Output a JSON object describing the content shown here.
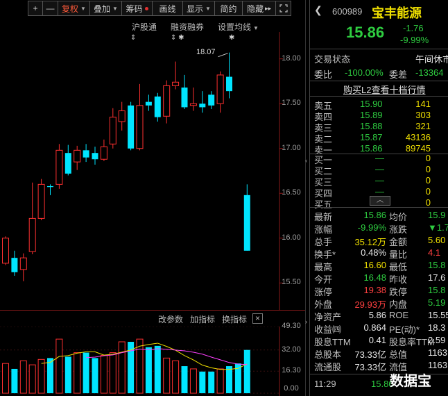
{
  "toolbar": {
    "plus": "+",
    "minus": "—",
    "fuquan": "复权",
    "diejia": "叠加",
    "chouma": "筹码",
    "huaxian": "画线",
    "xianshi": "显示",
    "jianyue": "简约",
    "yincang": "隐藏",
    "ff": "▸▸"
  },
  "indicators": {
    "hgt": "沪股通",
    "rzrq": "融资融券",
    "ma_setting": "设置均线"
  },
  "chart_annotation": "18.07",
  "y_labels": [
    "18.00",
    "17.50",
    "17.00",
    "16.50",
    "16.00",
    "15.50"
  ],
  "vol_labels": [
    "49.30",
    "32.00",
    "16.30",
    "0.00"
  ],
  "vol_toolbar": {
    "change_param": "改参数",
    "add_indicator": "加指标",
    "switch_indicator": "换指标",
    "close": "×"
  },
  "chart_data": {
    "type": "candlestick",
    "ylim": [
      15.2,
      18.3
    ],
    "candles": [
      {
        "o": 15.72,
        "c": 16.0,
        "h": 16.02,
        "l": 15.7
      },
      {
        "o": 15.78,
        "c": 15.62,
        "h": 15.86,
        "l": 15.58
      },
      {
        "o": 15.65,
        "c": 15.78,
        "h": 15.83,
        "l": 15.52
      },
      {
        "o": 15.85,
        "c": 16.22,
        "h": 16.62,
        "l": 15.82
      },
      {
        "o": 16.22,
        "c": 16.6,
        "h": 16.66,
        "l": 16.2
      },
      {
        "o": 16.58,
        "c": 16.57,
        "h": 16.6,
        "l": 16.48
      },
      {
        "o": 16.6,
        "c": 16.98,
        "h": 17.05,
        "l": 16.55
      },
      {
        "o": 16.95,
        "c": 16.72,
        "h": 17.04,
        "l": 16.7
      },
      {
        "o": 16.85,
        "c": 16.98,
        "h": 17.03,
        "l": 16.76
      },
      {
        "o": 16.98,
        "c": 16.9,
        "h": 17.05,
        "l": 16.85
      },
      {
        "o": 16.95,
        "c": 16.88,
        "h": 17.02,
        "l": 16.82
      },
      {
        "o": 16.88,
        "c": 17.02,
        "h": 17.1,
        "l": 16.86
      },
      {
        "o": 17.05,
        "c": 17.35,
        "h": 17.45,
        "l": 17.0
      },
      {
        "o": 17.3,
        "c": 17.42,
        "h": 17.52,
        "l": 17.2
      },
      {
        "o": 17.48,
        "c": 17.0,
        "h": 17.52,
        "l": 16.98
      },
      {
        "o": 17.0,
        "c": 17.48,
        "h": 17.72,
        "l": 16.98
      },
      {
        "o": 17.52,
        "c": 17.48,
        "h": 17.6,
        "l": 17.42
      },
      {
        "o": 17.58,
        "c": 17.35,
        "h": 17.62,
        "l": 17.3
      },
      {
        "o": 17.36,
        "c": 17.7,
        "h": 17.76,
        "l": 17.28
      },
      {
        "o": 17.7,
        "c": 17.74,
        "h": 17.97,
        "l": 17.66
      },
      {
        "o": 17.68,
        "c": 17.46,
        "h": 17.82,
        "l": 17.44
      },
      {
        "o": 17.48,
        "c": 17.5,
        "h": 17.68,
        "l": 17.42
      },
      {
        "o": 17.5,
        "c": 17.46,
        "h": 17.64,
        "l": 17.4
      },
      {
        "o": 17.6,
        "c": 17.48,
        "h": 17.64,
        "l": 17.44
      },
      {
        "o": 17.5,
        "c": 17.82,
        "h": 17.86,
        "l": 17.4
      },
      {
        "o": 17.8,
        "c": 17.64,
        "h": 18.07,
        "l": 17.56
      },
      {
        "skip": true
      },
      {
        "o": 16.48,
        "c": 15.86,
        "h": 16.6,
        "l": 15.86
      }
    ],
    "volume": [
      22,
      18,
      24,
      21,
      25,
      26,
      40,
      27,
      30,
      30,
      26,
      28,
      30,
      38,
      38,
      40,
      34,
      35,
      26,
      24,
      20,
      18,
      16,
      16,
      18,
      20,
      22,
      32
    ],
    "volume_up": [
      true,
      false,
      true,
      true,
      true,
      false,
      true,
      false,
      true,
      false,
      false,
      true,
      true,
      true,
      false,
      true,
      false,
      false,
      true,
      true,
      false,
      true,
      false,
      false,
      true,
      false,
      false,
      false
    ],
    "vol_ylim": [
      0,
      49.3
    ]
  },
  "stock": {
    "code": "600989",
    "name": "宝丰能源",
    "price": "15.86",
    "change": "-1.76",
    "pct": "-9.99%"
  },
  "status": {
    "label": "交易状态",
    "value": "午间休市"
  },
  "weibi": {
    "label": "委比",
    "value": "-100.00%",
    "label2": "委差",
    "value2": "-13364"
  },
  "l2_link": "购买L2查看十档行情",
  "sells": [
    {
      "label": "卖五",
      "price": "15.90",
      "vol": "141"
    },
    {
      "label": "卖四",
      "price": "15.89",
      "vol": "303"
    },
    {
      "label": "卖三",
      "price": "15.88",
      "vol": "321"
    },
    {
      "label": "卖二",
      "price": "15.87",
      "vol": "43136"
    },
    {
      "label": "卖一",
      "price": "15.86",
      "vol": "89745"
    }
  ],
  "buys": [
    {
      "label": "买一",
      "price": "—",
      "vol": "0"
    },
    {
      "label": "买二",
      "price": "—",
      "vol": "0"
    },
    {
      "label": "买三",
      "price": "—",
      "vol": "0"
    },
    {
      "label": "买四",
      "price": "—",
      "vol": "0"
    },
    {
      "label": "买五",
      "price": "—",
      "vol": "0"
    }
  ],
  "stats": [
    {
      "l1": "最新",
      "v1": "15.86",
      "c1": "green",
      "l2": "均价",
      "v2": "15.9",
      "c2": "green"
    },
    {
      "l1": "涨幅",
      "v1": "-9.99%",
      "c1": "green",
      "l2": "涨跌",
      "v2": "▼1.7",
      "c2": "green"
    },
    {
      "l1": "总手",
      "v1": "35.12万",
      "c1": "yellow",
      "l2": "金额",
      "v2": "5.60",
      "c2": "yellow"
    },
    {
      "l1": "换手*",
      "v1": "0.48%",
      "c1": "white",
      "l2": "量比",
      "v2": "4.1",
      "c2": "red"
    },
    {
      "l1": "最高",
      "v1": "16.60",
      "c1": "yellow",
      "l2": "最低",
      "v2": "15.8",
      "c2": "green"
    },
    {
      "l1": "今开",
      "v1": "16.48",
      "c1": "green",
      "l2": "昨收",
      "v2": "17.6",
      "c2": "white"
    },
    {
      "l1": "涨停",
      "v1": "19.38",
      "c1": "red",
      "l2": "跌停",
      "v2": "15.8",
      "c2": "green"
    },
    {
      "l1": "外盘",
      "v1": "29.93万",
      "c1": "red",
      "l2": "内盘",
      "v2": "5.19",
      "c2": "green"
    },
    {
      "l1": "净资产",
      "v1": "5.86",
      "c1": "white",
      "l2": "ROE",
      "v2": "15.55",
      "c2": "white"
    },
    {
      "l1": "收益㈣",
      "v1": "0.864",
      "c1": "white",
      "l2": "PE(动)*",
      "v2": "18.3",
      "c2": "white"
    },
    {
      "l1": "股息TTM",
      "v1": "0.41",
      "c1": "white",
      "l2": "股息率TTM",
      "v2": "2.59",
      "c2": "white"
    },
    {
      "l1": "总股本",
      "v1": "73.33亿",
      "c1": "white",
      "l2": "总值",
      "v2": "1163",
      "c2": "white"
    },
    {
      "l1": "流通股",
      "v1": "73.33亿",
      "c1": "white",
      "l2": "流值",
      "v2": "1163",
      "c2": "white"
    }
  ],
  "tick": {
    "time": "11:29",
    "price": "15.86"
  },
  "watermark": "数据宝"
}
